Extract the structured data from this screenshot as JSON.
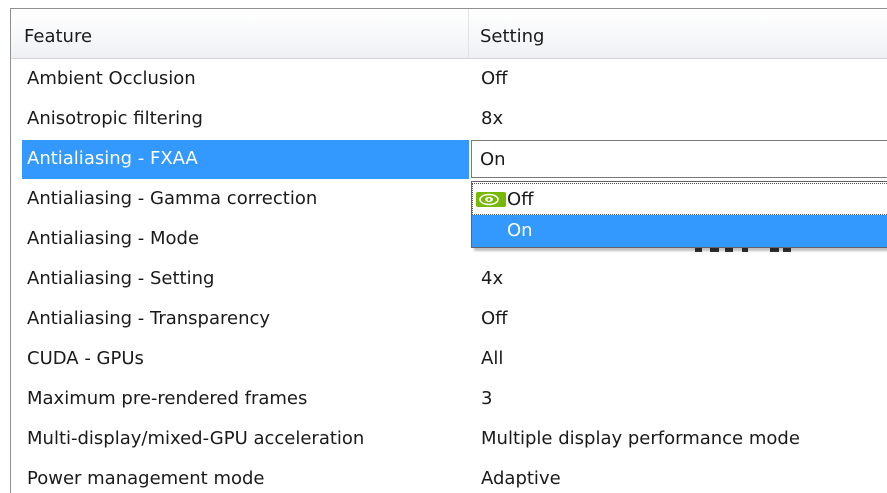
{
  "header": {
    "feature_label": "Feature",
    "setting_label": "Setting"
  },
  "rows": [
    {
      "feature": "Ambient Occlusion",
      "setting": "Off"
    },
    {
      "feature": "Anisotropic filtering",
      "setting": "8x"
    },
    {
      "feature": "Antialiasing - FXAA",
      "setting": "On"
    },
    {
      "feature": "Antialiasing - Gamma correction",
      "setting": ""
    },
    {
      "feature": "Antialiasing - Mode",
      "setting": ""
    },
    {
      "feature": "Antialiasing - Setting",
      "setting": "4x"
    },
    {
      "feature": "Antialiasing - Transparency",
      "setting": "Off"
    },
    {
      "feature": "CUDA - GPUs",
      "setting": "All"
    },
    {
      "feature": "Maximum pre-rendered frames",
      "setting": "3"
    },
    {
      "feature": "Multi-display/mixed-GPU acceleration",
      "setting": "Multiple display performance mode"
    },
    {
      "feature": "Power management mode",
      "setting": "Adaptive"
    }
  ],
  "dropdown": {
    "options": [
      {
        "label": "Off",
        "icon": "nvidia-logo-icon"
      },
      {
        "label": "On"
      }
    ],
    "selected": "On"
  },
  "colors": {
    "selection": "#3399ff",
    "nvidia_green": "#76b900"
  }
}
